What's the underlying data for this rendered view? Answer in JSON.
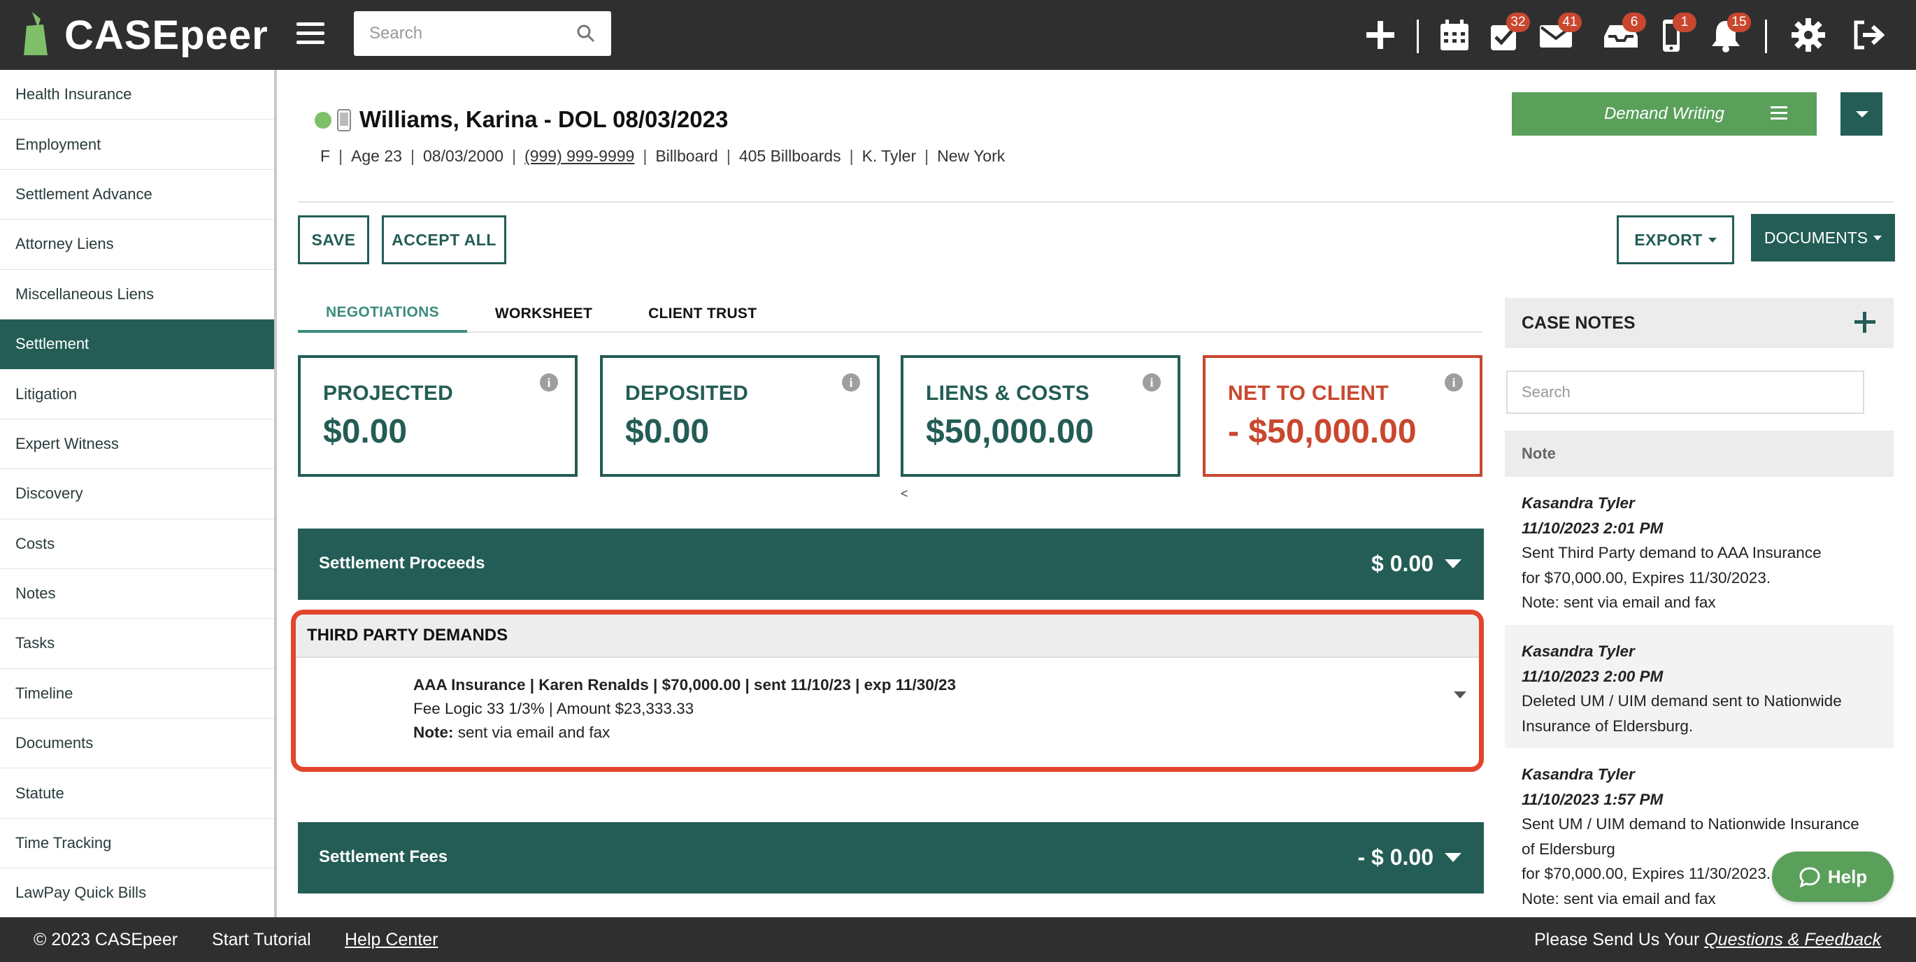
{
  "app": {
    "name": "CASEpeer",
    "colors": {
      "primary": "#235d55",
      "accent_green": "#5aa05b",
      "danger": "#c9472e",
      "topbar": "#2f2f2f"
    }
  },
  "topbar": {
    "search_placeholder": "Search",
    "icons": [
      {
        "name": "add-icon"
      },
      {
        "name": "calendar-icon"
      },
      {
        "name": "tasks-icon",
        "badge": "32"
      },
      {
        "name": "mail-icon",
        "badge": "41"
      },
      {
        "name": "inbox-icon",
        "badge": "6"
      },
      {
        "name": "mobile-icon",
        "badge": "1"
      },
      {
        "name": "bell-icon",
        "badge": "15"
      },
      {
        "name": "gear-icon"
      },
      {
        "name": "logout-icon"
      }
    ]
  },
  "sidebar": {
    "items": [
      {
        "label": "Health Insurance"
      },
      {
        "label": "Employment"
      },
      {
        "label": "Settlement Advance"
      },
      {
        "label": "Attorney Liens"
      },
      {
        "label": "Miscellaneous Liens"
      },
      {
        "label": "Settlement",
        "active": true
      },
      {
        "label": "Litigation"
      },
      {
        "label": "Expert Witness"
      },
      {
        "label": "Discovery"
      },
      {
        "label": "Costs"
      },
      {
        "label": "Notes"
      },
      {
        "label": "Tasks"
      },
      {
        "label": "Timeline"
      },
      {
        "label": "Documents"
      },
      {
        "label": "Statute"
      },
      {
        "label": "Time Tracking"
      },
      {
        "label": "LawPay Quick Bills"
      }
    ]
  },
  "case": {
    "title": "Williams, Karina - DOL 08/03/2023",
    "gender": "F",
    "age": "Age 23",
    "dob": "08/03/2000",
    "phone": "(999) 999-9999",
    "source": "Billboard",
    "source_detail": "405 Billboards",
    "attorney": "K. Tyler",
    "location": "New York",
    "status_color": "#7fbf6a"
  },
  "actions": {
    "demand_writing": "Demand Writing",
    "save": "SAVE",
    "accept_all": "ACCEPT ALL",
    "export": "EXPORT",
    "documents": "DOCUMENTS"
  },
  "tabs": [
    {
      "label": "NEGOTIATIONS",
      "active": true
    },
    {
      "label": "WORKSHEET"
    },
    {
      "label": "CLIENT TRUST"
    }
  ],
  "stats": [
    {
      "label": "PROJECTED",
      "value": "$0.00"
    },
    {
      "label": "DEPOSITED",
      "value": "$0.00"
    },
    {
      "label": "LIENS & COSTS",
      "value": "$50,000.00"
    },
    {
      "label": "NET TO CLIENT",
      "value": "- $50,000.00"
    }
  ],
  "lt_mark": "<",
  "settlement_proceeds": {
    "label": "Settlement Proceeds",
    "amount": "$ 0.00"
  },
  "third_party_demands": {
    "heading": "THIRD PARTY DEMANDS",
    "line1": "AAA Insurance | Karen Renalds | $70,000.00 | sent 11/10/23 | exp 11/30/23",
    "line2": "Fee Logic 33 1/3% | Amount $23,333.33",
    "note_label": "Note:",
    "note_text": " sent via email and fax"
  },
  "settlement_fees": {
    "label": "Settlement Fees",
    "amount": "- $ 0.00"
  },
  "case_notes": {
    "heading": "CASE NOTES",
    "search_placeholder": "Search",
    "column": "Note",
    "entries": [
      {
        "author": "Kasandra Tyler",
        "time": "11/10/2023 2:01 PM",
        "lines": [
          "Sent Third Party demand to AAA Insurance",
          "for $70,000.00, Expires 11/30/2023.",
          "Note: sent via email and fax"
        ]
      },
      {
        "author": "Kasandra Tyler",
        "time": "11/10/2023 2:00 PM",
        "lines": [
          "Deleted UM / UIM demand sent to Nationwide",
          "Insurance of Eldersburg."
        ]
      },
      {
        "author": "Kasandra Tyler",
        "time": "11/10/2023 1:57 PM",
        "lines": [
          "Sent UM / UIM demand to Nationwide Insurance",
          "of Eldersburg",
          "for $70,000.00, Expires 11/30/2023.",
          "Note: sent via email and fax"
        ]
      }
    ]
  },
  "help": {
    "label": "Help"
  },
  "footer": {
    "copyright": "© 2023 CASEpeer",
    "tutorial": "Start Tutorial",
    "help_center": "Help Center",
    "feedback_prefix": "Please Send Us Your ",
    "feedback_link": "Questions & Feedback"
  }
}
